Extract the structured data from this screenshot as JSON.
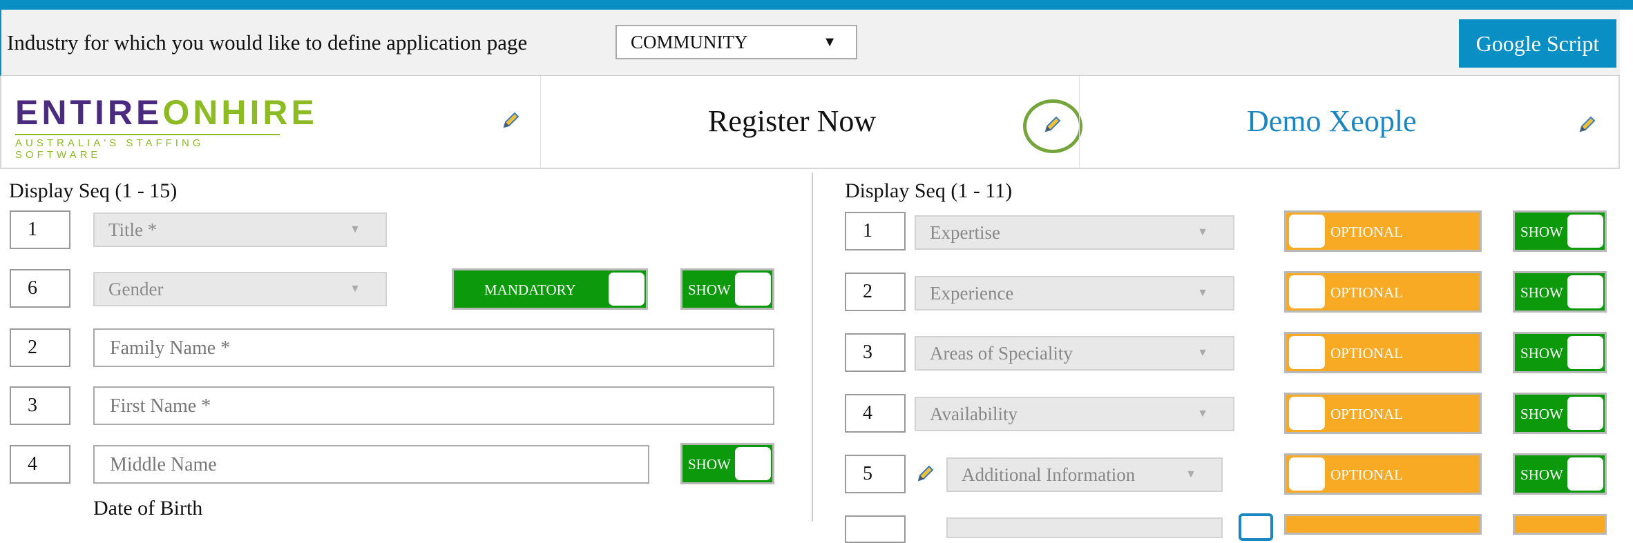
{
  "header": {
    "industry_label": "Industry for which you would like to define application page",
    "industry_value": "COMMUNITY",
    "google_script_label": "Google Script"
  },
  "branding": {
    "logo_part1": "ENTIRE",
    "logo_part2": "ONHIRE",
    "logo_tagline": "AUSTRALIA'S STAFFING SOFTWARE",
    "register_title": "Register Now",
    "company_title": "Demo Xeople"
  },
  "left_panel": {
    "seq_heading": "Display Seq (1 - 15)",
    "rows": [
      {
        "seq": "1",
        "field": "Title *"
      },
      {
        "seq": "6",
        "field": "Gender",
        "mandatory_label": "MANDATORY",
        "show_label": "SHOW"
      },
      {
        "seq": "2",
        "field": "Family Name *"
      },
      {
        "seq": "3",
        "field": "First Name *"
      },
      {
        "seq": "4",
        "field": "Middle Name",
        "show_label": "SHOW"
      }
    ],
    "dob_label": "Date of Birth"
  },
  "right_panel": {
    "seq_heading": "Display Seq (1 - 11)",
    "rows": [
      {
        "seq": "1",
        "field": "Expertise",
        "optional_label": "OPTIONAL",
        "show_label": "SHOW"
      },
      {
        "seq": "2",
        "field": "Experience",
        "optional_label": "OPTIONAL",
        "show_label": "SHOW"
      },
      {
        "seq": "3",
        "field": "Areas of Speciality",
        "optional_label": "OPTIONAL",
        "show_label": "SHOW"
      },
      {
        "seq": "4",
        "field": "Availability",
        "optional_label": "OPTIONAL",
        "show_label": "SHOW"
      },
      {
        "seq": "5",
        "field": "Additional Information",
        "optional_label": "OPTIONAL",
        "show_label": "SHOW"
      }
    ]
  },
  "colors": {
    "accent": "#0a8fc4",
    "mandatory": "#0c9a0c",
    "optional": "#f8aa24",
    "highlight": "#74a53a"
  }
}
